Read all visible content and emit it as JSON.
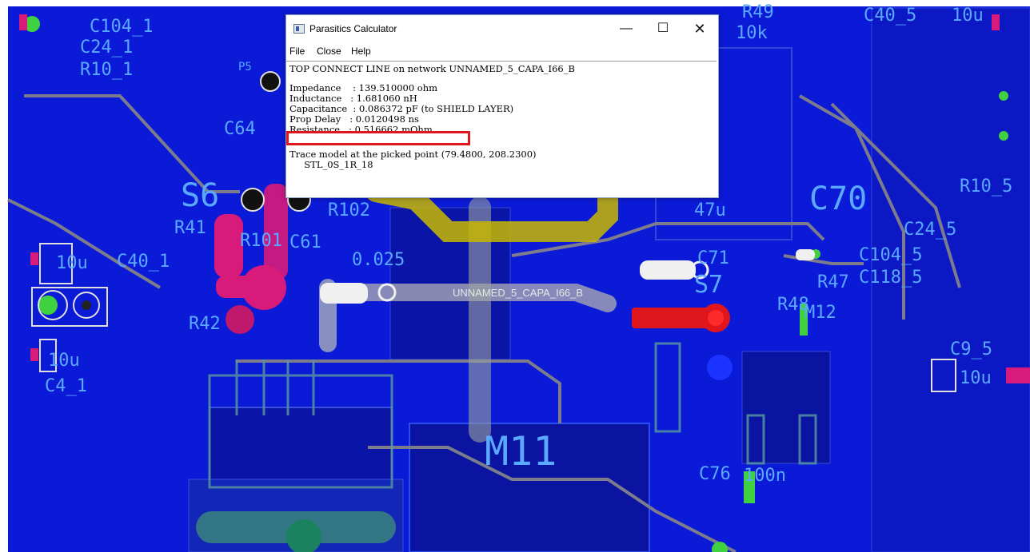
{
  "pcb": {
    "labels": {
      "c104_1": "C104_1",
      "c24_1": "C24_1",
      "r10_1": "R10_1",
      "p5": "P5",
      "c64": "C64",
      "s6": "S6",
      "r41": "R41",
      "r101": "R101",
      "r102": "R102",
      "c61": "C61",
      "val_025": "0.025",
      "c40_1": "C40_1",
      "r42": "R42",
      "c4_1": "C4_1",
      "val_10u_a": "10u",
      "val_10u_b": "10u",
      "m11": "M11",
      "c70": "C70",
      "c71": "C71",
      "s7": "S7",
      "r47": "R47",
      "r48": "R48",
      "m12": "M12",
      "c76": "C76",
      "val_100n": "100n",
      "r49": "R49",
      "c40_5": "C40_5",
      "val_10u_c": "10u",
      "r10_5": "R10_5",
      "c24_5": "C24_5",
      "c104_5": "C104_5",
      "c118_5": "C118_5",
      "c9_5": "C9_5",
      "val_10u_d": "10u",
      "net_label": "UNNAMED_5_CAPA_I66_B",
      "val_47u": "47u",
      "val_10k": "10k"
    }
  },
  "dialog": {
    "title": "Parasitics Calculator",
    "buttons": {
      "minimize": "—",
      "maximize": "☐",
      "close": "✕"
    },
    "menu": {
      "file": "File",
      "close": "Close",
      "help": "Help"
    },
    "header": "TOP CONNECT LINE on network UNNAMED_5_CAPA_I66_B",
    "impedance": "Impedance    : 139.510000 ohm",
    "inductance": "Inductance   : 1.681060 nH",
    "capacitance": "Capacitance  : 0.086372 pF (to SHIELD LAYER)",
    "prop_delay": "Prop Delay   : 0.0120498 ns",
    "resistance": "Resistance   : 0.516662 mOhm",
    "trace_model": "Trace model at the picked point (79.4800, 208.2300)",
    "model_name": "     STL_0S_1R_18"
  },
  "colors": {
    "board": "#0b1ad6",
    "silkscreen": "#5aa9ff",
    "trace_gray": "#8a8a9a",
    "highlight_red": "#e0161e",
    "pad_green": "#3fd13f",
    "pad_magenta": "#d81b7a",
    "pad_yellow": "#c9b800"
  }
}
